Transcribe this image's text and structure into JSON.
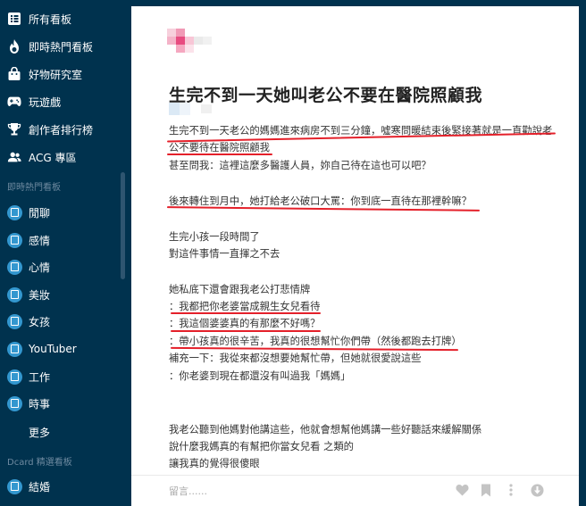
{
  "sidebar": {
    "top_items": [
      {
        "label": "所有看板",
        "icon": "board-list-icon"
      },
      {
        "label": "即時熱門看板",
        "icon": "fire-icon"
      },
      {
        "label": "好物研究室",
        "icon": "shopping-bag-icon"
      },
      {
        "label": "玩遊戲",
        "icon": "gamepad-icon"
      },
      {
        "label": "創作者排行榜",
        "icon": "trophy-icon"
      },
      {
        "label": "ACG 專區",
        "icon": "people-icon"
      }
    ],
    "hot_section_title": "即時熱門看板",
    "hot_boards": [
      {
        "label": "閒聊"
      },
      {
        "label": "感情"
      },
      {
        "label": "心情"
      },
      {
        "label": "美妝"
      },
      {
        "label": "女孩"
      },
      {
        "label": "YouTuber"
      },
      {
        "label": "工作"
      },
      {
        "label": "時事"
      }
    ],
    "more_label": "更多",
    "featured_section_title": "Dcard 精選看板",
    "featured_boards": [
      {
        "label": "結婚"
      }
    ],
    "accent_color": "#3397cf",
    "background_color": "#00324e"
  },
  "post": {
    "title": "生完不到一天她叫老公不要在醫院照顧我",
    "lines": [
      "生完不到一天老公的媽媽進來病房不到三分鐘，噓寒問暖結束後緊接著就是一直勸說老",
      "公不要待在醫院照顧我",
      "甚至問我：這裡這麼多醫護人員，妳自己待在這也可以吧？",
      "後來轉住到月中，她打給老公破口大罵：你到底一直待在那裡幹嘛？",
      "生完小孩一段時間了",
      "對這件事情一直揮之不去",
      "她私底下還會跟我老公打悲情牌",
      "：我都把你老婆當成親生女兒看待",
      "：我這個婆婆真的有那麼不好嗎？",
      "：帶小孩真的很辛苦，我真的很想幫忙你們帶（然後都跑去打牌）",
      "補充一下：我從來都沒想要她幫忙帶，但她就很愛說這些",
      "：你老婆到現在都還沒有叫過我「媽媽」",
      "我老公聽到他媽對他講這些，他就會想幫他媽講一些好聽話來緩解關係",
      "說什麼我媽真的有幫把你當女兒看 之類的",
      "讓我真的覺得很傻眼"
    ],
    "highlight_color": "#e4202a"
  },
  "footer": {
    "comment_placeholder": "留言......",
    "icons": [
      "heart-icon",
      "bookmark-icon",
      "more-icon",
      "download-icon"
    ]
  }
}
